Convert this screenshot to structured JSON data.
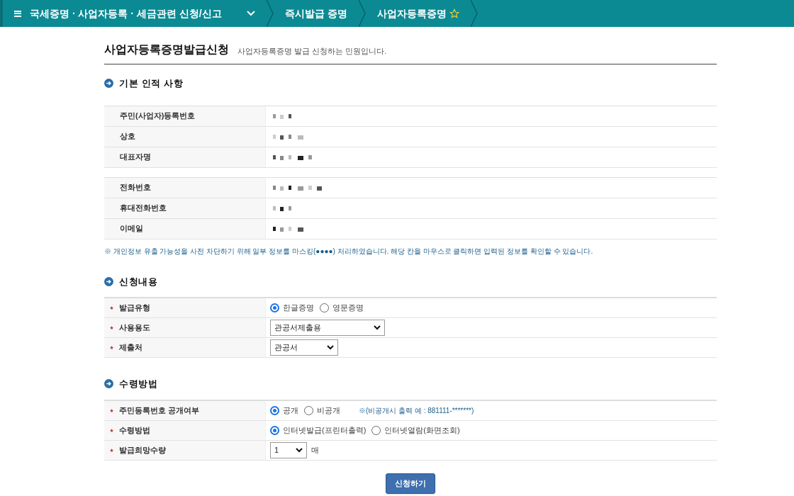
{
  "breadcrumb": {
    "items": [
      {
        "label": "국세증명 · 사업자등록 · 세금관련 신청/신고",
        "dropdown": true
      },
      {
        "label": "즉시발급 증명",
        "dropdown": false
      },
      {
        "label": "사업자등록증명",
        "dropdown": false
      }
    ],
    "favorite": false
  },
  "page": {
    "title": "사업자등록증명발급신청",
    "description": "사업자등록증명 발급 신청하는 민원입니다."
  },
  "basic_info": {
    "title": "기본 인적 사항",
    "groups": [
      [
        {
          "label": "주민(사업자)등록번호"
        },
        {
          "label": "상호"
        },
        {
          "label": "대표자명"
        }
      ],
      [
        {
          "label": "전화번호"
        },
        {
          "label": "휴대전화번호"
        },
        {
          "label": "이메일"
        }
      ]
    ],
    "note": "※ 개인정보 유출 가능성을 사전 차단하기 위해 일부 정보를 마스킹(●●●●) 처리하였습니다. 해당 칸을 마우스로 클릭하면 입력된 정보를 확인할 수 있습니다."
  },
  "sections": [
    {
      "title": "신청내용",
      "rows": [
        {
          "label": "발급유형",
          "required": true,
          "kind": "radio",
          "options": [
            {
              "label": "한글증명",
              "selected": true
            },
            {
              "label": "영문증명",
              "selected": false
            }
          ]
        },
        {
          "label": "사용용도",
          "required": true,
          "kind": "select",
          "value": "관공서제출용"
        },
        {
          "label": "제출처",
          "required": true,
          "kind": "select",
          "value": "관공서"
        }
      ]
    },
    {
      "title": "수령방법",
      "rows": [
        {
          "label": "주민등록번호 공개여부",
          "required": true,
          "kind": "radio",
          "options": [
            {
              "label": "공개",
              "selected": true
            },
            {
              "label": "비공개",
              "selected": false
            }
          ],
          "note": "※(비공개시 출력 예 : 881111-*******)"
        },
        {
          "label": "수령방법",
          "required": true,
          "kind": "radio",
          "options": [
            {
              "label": "인터넷발급(프린터출력)",
              "selected": true
            },
            {
              "label": "인터넷열람(화면조회)",
              "selected": false
            }
          ]
        },
        {
          "label": "발급희망수량",
          "required": true,
          "kind": "select",
          "value": "1",
          "unit": "매"
        }
      ]
    }
  ],
  "submit": "신청하기"
}
